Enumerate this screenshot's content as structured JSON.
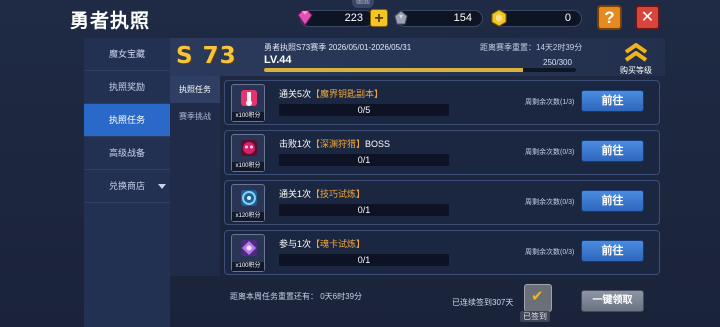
{
  "header": {
    "title": "勇者执照",
    "avatar_tab": "画面",
    "currencies": {
      "gems": "223",
      "ore": "154",
      "coins": "0"
    },
    "plus_label": "+",
    "help_label": "?",
    "close_label": "✕"
  },
  "leftnav": {
    "items": [
      {
        "label": "魔女宝藏"
      },
      {
        "label": "执照奖励"
      },
      {
        "label": "执照任务"
      },
      {
        "label": "高级战备"
      },
      {
        "label": "兑换商店"
      }
    ]
  },
  "subnav": {
    "items": [
      {
        "label": "执照任务"
      },
      {
        "label": "赛季挑战"
      }
    ]
  },
  "season": {
    "badge": "S 73",
    "title": "勇者执照S73赛季 2026/05/01-2026/05/31",
    "reset": "距离赛季重置：14天2时39分",
    "level": "LV.44",
    "exp": "250/300",
    "exp_fraction": 0.83,
    "buy_label": "购买等级"
  },
  "tasks": [
    {
      "name_prefix": "通关5次",
      "name_highlight": "【魔界钥匙副本】",
      "name_suffix": "",
      "progress": "0/5",
      "points": "x100积分",
      "remaining": "周剩余次数(1/3)",
      "button": "前往",
      "icon_color": "#d8d8e0"
    },
    {
      "name_prefix": "击败1次",
      "name_highlight": "【深渊狩猎】",
      "name_suffix": "BOSS",
      "progress": "0/1",
      "points": "x100积分",
      "remaining": "周剩余次数(0/3)",
      "button": "前往",
      "icon_color": "#d8206a"
    },
    {
      "name_prefix": "通关1次",
      "name_highlight": "【技巧试炼】",
      "name_suffix": "",
      "progress": "0/1",
      "points": "x120积分",
      "remaining": "周剩余次数(0/3)",
      "button": "前往",
      "icon_color": "#3ea0e0"
    },
    {
      "name_prefix": "参与1次",
      "name_highlight": "【魂卡试炼】",
      "name_suffix": "",
      "progress": "0/1",
      "points": "x100积分",
      "remaining": "周剩余次数(0/3)",
      "button": "前往",
      "icon_color": "#b778f0"
    }
  ],
  "footer": {
    "countdown": "距离本周任务重置还有： 0天6时39分",
    "signed": "已连续签到307天",
    "calendar_label": "已签到",
    "claim_all": "一键领取"
  }
}
